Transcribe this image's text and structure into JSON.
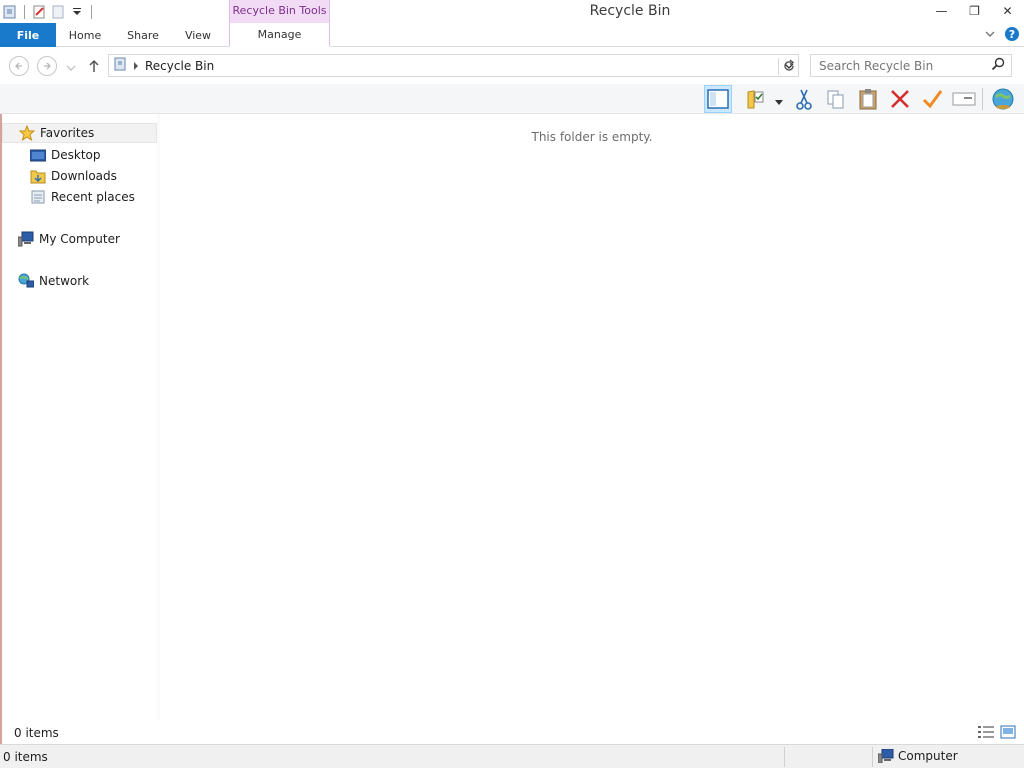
{
  "window": {
    "title": "Recycle Bin",
    "contextual_tab_group": "Recycle Bin Tools",
    "minimize_glyph": "—",
    "restore_glyph": "❐",
    "close_glyph": "✕"
  },
  "ribbon": {
    "tabs": [
      {
        "label": "File"
      },
      {
        "label": "Home"
      },
      {
        "label": "Share"
      },
      {
        "label": "View"
      },
      {
        "label": "Manage"
      }
    ],
    "help_icon": "help-icon",
    "expand_icon": "chevron-down-icon"
  },
  "address": {
    "breadcrumb": "Recycle Bin",
    "search_placeholder": "Search Recycle Bin"
  },
  "toolbar": {
    "icons": [
      "preview-pane-icon",
      "folder-properties-icon",
      "cut-icon",
      "copy-icon",
      "paste-icon",
      "delete-icon",
      "checkmark-icon",
      "rename-icon",
      "globe-icon"
    ]
  },
  "nav": {
    "favorites": "Favorites",
    "desktop": "Desktop",
    "downloads": "Downloads",
    "recent": "Recent places",
    "computer": "My Computer",
    "network": "Network"
  },
  "content": {
    "empty_message": "This folder is empty."
  },
  "status": {
    "item_count": "0 items",
    "footer_count": "0 items",
    "zone": "Computer"
  },
  "colors": {
    "file_tab": "#1979ca",
    "contextual": "#f2dcf5",
    "contextual_text": "#7d2f8b",
    "selection": "#cce8ff"
  }
}
